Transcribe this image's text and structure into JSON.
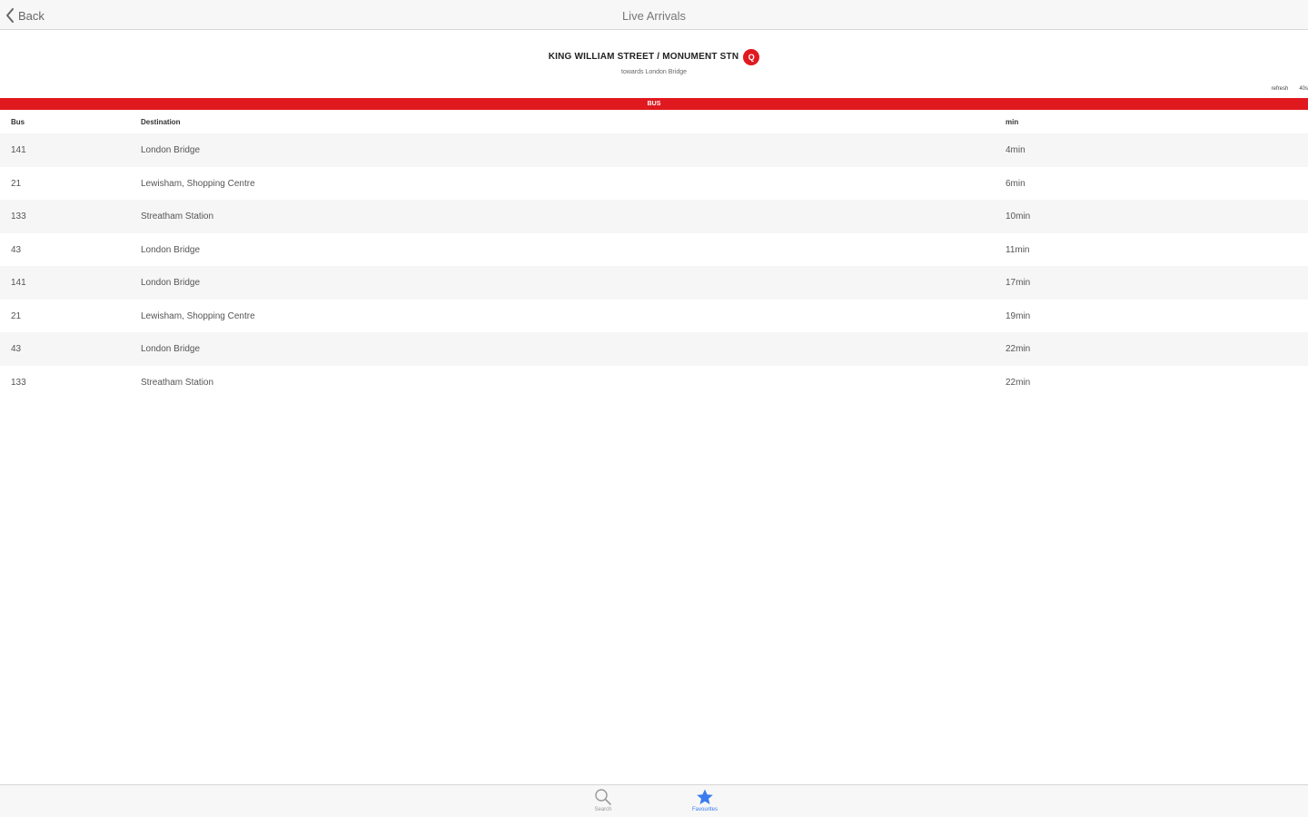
{
  "navbar": {
    "back_label": "Back",
    "title": "Live Arrivals"
  },
  "stop": {
    "name": "KING WILLIAM STREET / MONUMENT STN",
    "badge_letter": "Q",
    "towards": "towards London Bridge"
  },
  "refresh": {
    "label": "refresh",
    "value": "40s"
  },
  "section_label": "BUS",
  "table": {
    "headers": {
      "bus": "Bus",
      "destination": "Destination",
      "min": "min"
    },
    "rows": [
      {
        "bus": "141",
        "destination": "London Bridge",
        "min": "4min"
      },
      {
        "bus": "21",
        "destination": "Lewisham, Shopping Centre",
        "min": "6min"
      },
      {
        "bus": "133",
        "destination": "Streatham Station",
        "min": "10min"
      },
      {
        "bus": "43",
        "destination": "London Bridge",
        "min": "11min"
      },
      {
        "bus": "141",
        "destination": "London Bridge",
        "min": "17min"
      },
      {
        "bus": "21",
        "destination": "Lewisham, Shopping Centre",
        "min": "19min"
      },
      {
        "bus": "43",
        "destination": "London Bridge",
        "min": "22min"
      },
      {
        "bus": "133",
        "destination": "Streatham Station",
        "min": "22min"
      }
    ]
  },
  "tabbar": {
    "search_label": "Search",
    "search_icon": "search-icon",
    "favourites_label": "Favourites",
    "favourites_icon": "star-icon",
    "active_tab": "favourites"
  },
  "colors": {
    "brand_red": "#e0191f",
    "active_blue": "#3a7bf0",
    "nav_bg": "#f7f7f7"
  }
}
